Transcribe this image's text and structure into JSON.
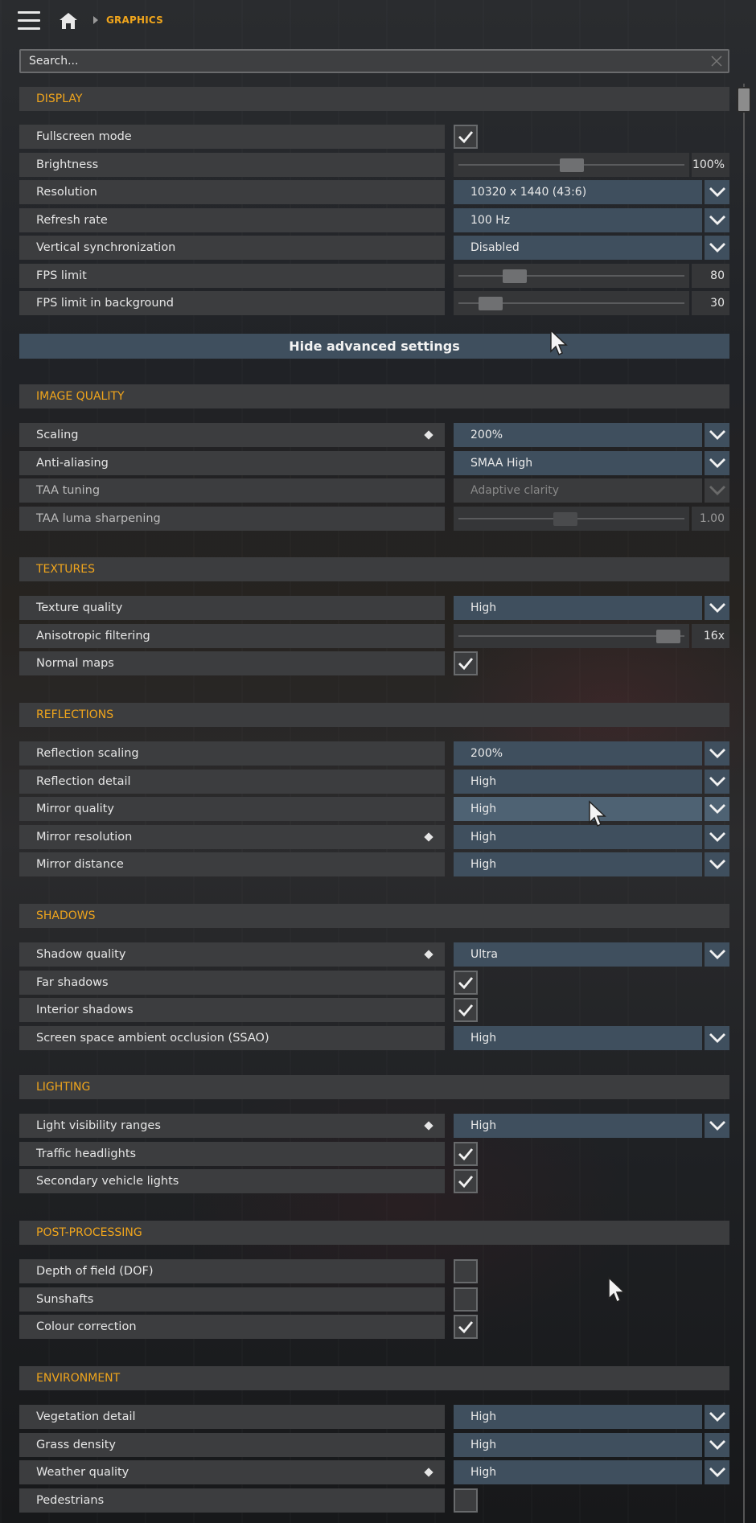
{
  "header": {
    "breadcrumb": "GRAPHICS"
  },
  "search": {
    "placeholder": "Search..."
  },
  "advanced_button": "Hide advanced settings",
  "colors": {
    "accent": "#f0a51c",
    "control_blue": "#3f4f5e",
    "row_bg": "#3c3d3f"
  },
  "sections": [
    {
      "title": "DISPLAY",
      "rows": [
        {
          "label": "Fullscreen mode",
          "type": "checkbox",
          "checked": true
        },
        {
          "label": "Brightness",
          "type": "slider",
          "value": "100%",
          "fraction": 0.5
        },
        {
          "label": "Resolution",
          "type": "dropdown",
          "value": "10320 x 1440 (43:6)"
        },
        {
          "label": "Refresh rate",
          "type": "dropdown",
          "value": "100 Hz"
        },
        {
          "label": "Vertical synchronization",
          "type": "dropdown",
          "value": "Disabled"
        },
        {
          "label": "FPS limit",
          "type": "slider",
          "value": "80",
          "fraction": 0.22
        },
        {
          "label": "FPS limit in background",
          "type": "slider",
          "value": "30",
          "fraction": 0.1
        }
      ]
    },
    {
      "title": "IMAGE QUALITY",
      "rows": [
        {
          "label": "Scaling",
          "type": "dropdown",
          "value": "200%",
          "marked": true
        },
        {
          "label": "Anti-aliasing",
          "type": "dropdown",
          "value": "SMAA High"
        },
        {
          "label": "TAA tuning",
          "type": "dropdown",
          "value": "Adaptive clarity",
          "disabled": true
        },
        {
          "label": "TAA luma sharpening",
          "type": "slider",
          "value": "1.00",
          "fraction": 0.47,
          "disabled": true
        }
      ]
    },
    {
      "title": "TEXTURES",
      "rows": [
        {
          "label": "Texture quality",
          "type": "dropdown",
          "value": "High"
        },
        {
          "label": "Anisotropic filtering",
          "type": "slider",
          "value": "16x",
          "fraction": 0.98
        },
        {
          "label": "Normal maps",
          "type": "checkbox",
          "checked": true
        }
      ]
    },
    {
      "title": "REFLECTIONS",
      "rows": [
        {
          "label": "Reflection scaling",
          "type": "dropdown",
          "value": "200%"
        },
        {
          "label": "Reflection detail",
          "type": "dropdown",
          "value": "High"
        },
        {
          "label": "Mirror quality",
          "type": "dropdown",
          "value": "High",
          "hover": true
        },
        {
          "label": "Mirror resolution",
          "type": "dropdown",
          "value": "High",
          "marked": true
        },
        {
          "label": "Mirror distance",
          "type": "dropdown",
          "value": "High"
        }
      ]
    },
    {
      "title": "SHADOWS",
      "rows": [
        {
          "label": "Shadow quality",
          "type": "dropdown",
          "value": "Ultra",
          "marked": true
        },
        {
          "label": "Far shadows",
          "type": "checkbox",
          "checked": true
        },
        {
          "label": "Interior shadows",
          "type": "checkbox",
          "checked": true
        },
        {
          "label": "Screen space ambient occlusion (SSAO)",
          "type": "dropdown",
          "value": "High"
        }
      ]
    },
    {
      "title": "LIGHTING",
      "rows": [
        {
          "label": "Light visibility ranges",
          "type": "dropdown",
          "value": "High",
          "marked": true
        },
        {
          "label": "Traffic headlights",
          "type": "checkbox",
          "checked": true
        },
        {
          "label": "Secondary vehicle lights",
          "type": "checkbox",
          "checked": true
        }
      ]
    },
    {
      "title": "POST-PROCESSING",
      "rows": [
        {
          "label": "Depth of field (DOF)",
          "type": "checkbox",
          "checked": false
        },
        {
          "label": "Sunshafts",
          "type": "checkbox",
          "checked": false
        },
        {
          "label": "Colour correction",
          "type": "checkbox",
          "checked": true
        }
      ]
    },
    {
      "title": "ENVIRONMENT",
      "rows": [
        {
          "label": "Vegetation detail",
          "type": "dropdown",
          "value": "High"
        },
        {
          "label": "Grass density",
          "type": "dropdown",
          "value": "High"
        },
        {
          "label": "Weather quality",
          "type": "dropdown",
          "value": "High",
          "marked": true
        },
        {
          "label": "Pedestrians",
          "type": "checkbox",
          "checked": false
        }
      ]
    }
  ]
}
